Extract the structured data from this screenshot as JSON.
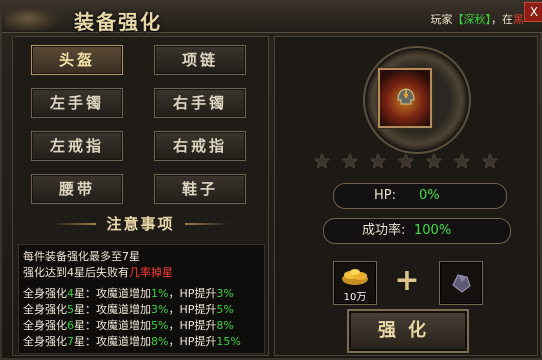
{
  "window": {
    "title": "装备强化",
    "banner": {
      "prefix": "玩家",
      "player": "【深秋】",
      "middle": "，在",
      "cut": "黑"
    },
    "close_label": "X"
  },
  "slots": [
    {
      "label": "头盔",
      "active": true
    },
    {
      "label": "项链"
    },
    {
      "label": "左手镯"
    },
    {
      "label": "右手镯"
    },
    {
      "label": "左戒指"
    },
    {
      "label": "右戒指"
    },
    {
      "label": "腰带"
    },
    {
      "label": "鞋子"
    }
  ],
  "notice": {
    "title": "注意事项",
    "line1": "每件装备强化最多至7星",
    "line2_a": "强化达到4星后失败有",
    "line2_b": "几率掉星",
    "rows": [
      {
        "a": "全身强化",
        "n": "4",
        "b": "星：攻魔道增加",
        "p": "1%",
        "c": "，HP提升",
        "q": "3%"
      },
      {
        "a": "全身强化",
        "n": "5",
        "b": "星：攻魔道增加",
        "p": "3%",
        "c": "，HP提升",
        "q": "5%"
      },
      {
        "a": "全身强化",
        "n": "6",
        "b": "星：攻魔道增加",
        "p": "5%",
        "c": "，HP提升",
        "q": "8%"
      },
      {
        "a": "全身强化",
        "n": "7",
        "b": "星：攻魔道增加",
        "p": "8%",
        "c": "，HP提升",
        "q": "15%"
      }
    ]
  },
  "item": {
    "icon": "helmet-icon",
    "stars_total": 7,
    "stars_filled": 0
  },
  "stats": {
    "hp_label": "HP:",
    "hp_value": "0%",
    "rate_label": "成功率:",
    "rate_value": "100%"
  },
  "materials": {
    "gold_icon": "gold-ingot-icon",
    "gold_count": "10万",
    "ore_icon": "ore-stone-icon",
    "plus": "+"
  },
  "enhance_button": "强化",
  "colors": {
    "accent_green": "#35d43b",
    "accent_red": "#ff3b2d",
    "gold": "#ead9a8"
  }
}
